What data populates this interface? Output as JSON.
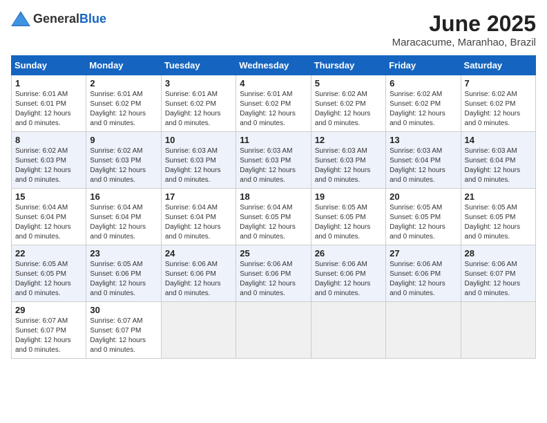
{
  "header": {
    "logo_general": "General",
    "logo_blue": "Blue",
    "month_year": "June 2025",
    "location": "Maracacume, Maranhao, Brazil"
  },
  "calendar": {
    "days_of_week": [
      "Sunday",
      "Monday",
      "Tuesday",
      "Wednesday",
      "Thursday",
      "Friday",
      "Saturday"
    ],
    "weeks": [
      [
        {
          "day": "1",
          "sunrise": "6:01 AM",
          "sunset": "6:01 PM",
          "daylight": "12 hours and 0 minutes."
        },
        {
          "day": "2",
          "sunrise": "6:01 AM",
          "sunset": "6:02 PM",
          "daylight": "12 hours and 0 minutes."
        },
        {
          "day": "3",
          "sunrise": "6:01 AM",
          "sunset": "6:02 PM",
          "daylight": "12 hours and 0 minutes."
        },
        {
          "day": "4",
          "sunrise": "6:01 AM",
          "sunset": "6:02 PM",
          "daylight": "12 hours and 0 minutes."
        },
        {
          "day": "5",
          "sunrise": "6:02 AM",
          "sunset": "6:02 PM",
          "daylight": "12 hours and 0 minutes."
        },
        {
          "day": "6",
          "sunrise": "6:02 AM",
          "sunset": "6:02 PM",
          "daylight": "12 hours and 0 minutes."
        },
        {
          "day": "7",
          "sunrise": "6:02 AM",
          "sunset": "6:02 PM",
          "daylight": "12 hours and 0 minutes."
        }
      ],
      [
        {
          "day": "8",
          "sunrise": "6:02 AM",
          "sunset": "6:03 PM",
          "daylight": "12 hours and 0 minutes."
        },
        {
          "day": "9",
          "sunrise": "6:02 AM",
          "sunset": "6:03 PM",
          "daylight": "12 hours and 0 minutes."
        },
        {
          "day": "10",
          "sunrise": "6:03 AM",
          "sunset": "6:03 PM",
          "daylight": "12 hours and 0 minutes."
        },
        {
          "day": "11",
          "sunrise": "6:03 AM",
          "sunset": "6:03 PM",
          "daylight": "12 hours and 0 minutes."
        },
        {
          "day": "12",
          "sunrise": "6:03 AM",
          "sunset": "6:03 PM",
          "daylight": "12 hours and 0 minutes."
        },
        {
          "day": "13",
          "sunrise": "6:03 AM",
          "sunset": "6:04 PM",
          "daylight": "12 hours and 0 minutes."
        },
        {
          "day": "14",
          "sunrise": "6:03 AM",
          "sunset": "6:04 PM",
          "daylight": "12 hours and 0 minutes."
        }
      ],
      [
        {
          "day": "15",
          "sunrise": "6:04 AM",
          "sunset": "6:04 PM",
          "daylight": "12 hours and 0 minutes."
        },
        {
          "day": "16",
          "sunrise": "6:04 AM",
          "sunset": "6:04 PM",
          "daylight": "12 hours and 0 minutes."
        },
        {
          "day": "17",
          "sunrise": "6:04 AM",
          "sunset": "6:04 PM",
          "daylight": "12 hours and 0 minutes."
        },
        {
          "day": "18",
          "sunrise": "6:04 AM",
          "sunset": "6:05 PM",
          "daylight": "12 hours and 0 minutes."
        },
        {
          "day": "19",
          "sunrise": "6:05 AM",
          "sunset": "6:05 PM",
          "daylight": "12 hours and 0 minutes."
        },
        {
          "day": "20",
          "sunrise": "6:05 AM",
          "sunset": "6:05 PM",
          "daylight": "12 hours and 0 minutes."
        },
        {
          "day": "21",
          "sunrise": "6:05 AM",
          "sunset": "6:05 PM",
          "daylight": "12 hours and 0 minutes."
        }
      ],
      [
        {
          "day": "22",
          "sunrise": "6:05 AM",
          "sunset": "6:05 PM",
          "daylight": "12 hours and 0 minutes."
        },
        {
          "day": "23",
          "sunrise": "6:05 AM",
          "sunset": "6:06 PM",
          "daylight": "12 hours and 0 minutes."
        },
        {
          "day": "24",
          "sunrise": "6:06 AM",
          "sunset": "6:06 PM",
          "daylight": "12 hours and 0 minutes."
        },
        {
          "day": "25",
          "sunrise": "6:06 AM",
          "sunset": "6:06 PM",
          "daylight": "12 hours and 0 minutes."
        },
        {
          "day": "26",
          "sunrise": "6:06 AM",
          "sunset": "6:06 PM",
          "daylight": "12 hours and 0 minutes."
        },
        {
          "day": "27",
          "sunrise": "6:06 AM",
          "sunset": "6:06 PM",
          "daylight": "12 hours and 0 minutes."
        },
        {
          "day": "28",
          "sunrise": "6:06 AM",
          "sunset": "6:07 PM",
          "daylight": "12 hours and 0 minutes."
        }
      ],
      [
        {
          "day": "29",
          "sunrise": "6:07 AM",
          "sunset": "6:07 PM",
          "daylight": "12 hours and 0 minutes."
        },
        {
          "day": "30",
          "sunrise": "6:07 AM",
          "sunset": "6:07 PM",
          "daylight": "12 hours and 0 minutes."
        },
        null,
        null,
        null,
        null,
        null
      ]
    ]
  }
}
